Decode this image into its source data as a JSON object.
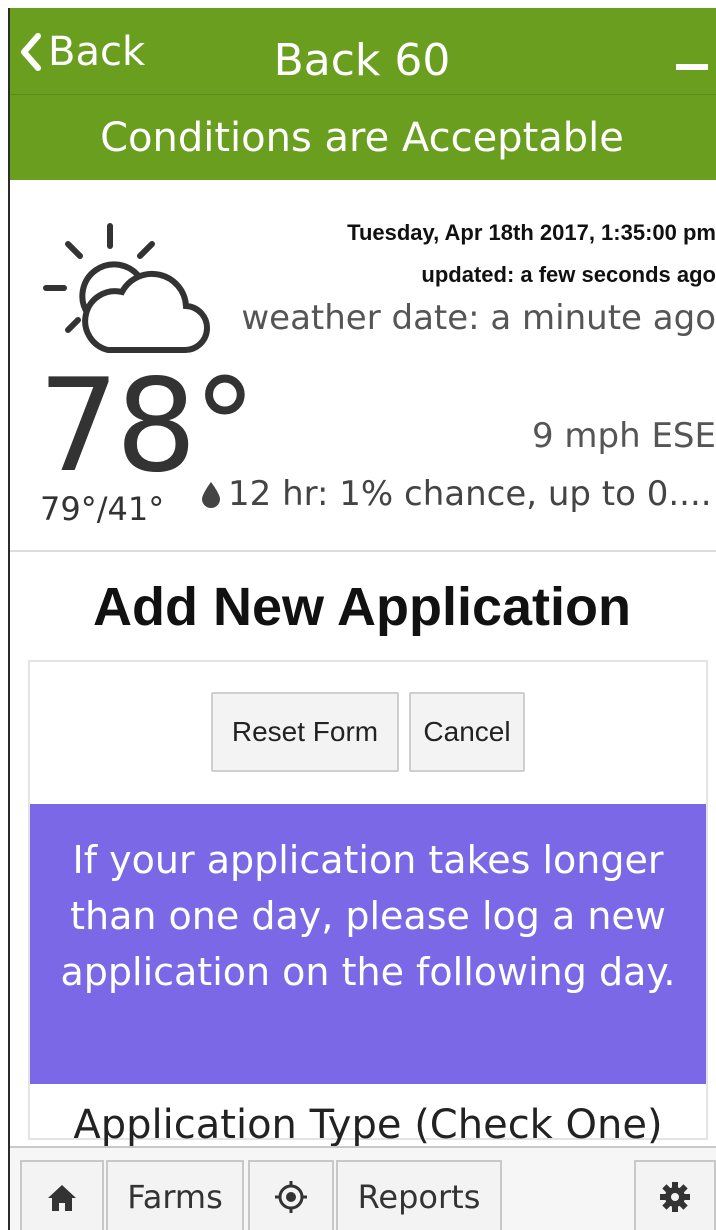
{
  "header": {
    "back_label": "Back",
    "title": "Back 60",
    "minimize_icon": "minus-icon",
    "conditions": "Conditions are Acceptable"
  },
  "colors": {
    "header_green": "#6a9e1f",
    "notice_purple": "#7b68e6"
  },
  "weather": {
    "icon": "partly-cloudy-icon",
    "datetime": "Tuesday, Apr 18th 2017, 1:35:00 pm",
    "updated": "updated: a few seconds ago",
    "weather_date": "weather date: a minute ago",
    "temperature": "78°",
    "wind": "9 mph ESE",
    "hi_lo": "79°/41°",
    "precip_icon": "raindrop-icon",
    "precip": "12 hr: 1% chance, up to 0...."
  },
  "form": {
    "title": "Add New Application",
    "reset_label": "Reset Form",
    "cancel_label": "Cancel",
    "notice": "If your application takes longer than one day, please log a new application on the following day.",
    "application_type_label": "Application Type (Check One)"
  },
  "nav": {
    "home_icon": "home-icon",
    "farms_label": "Farms",
    "target_icon": "location-target-icon",
    "reports_label": "Reports",
    "settings_icon": "gear-icon"
  }
}
